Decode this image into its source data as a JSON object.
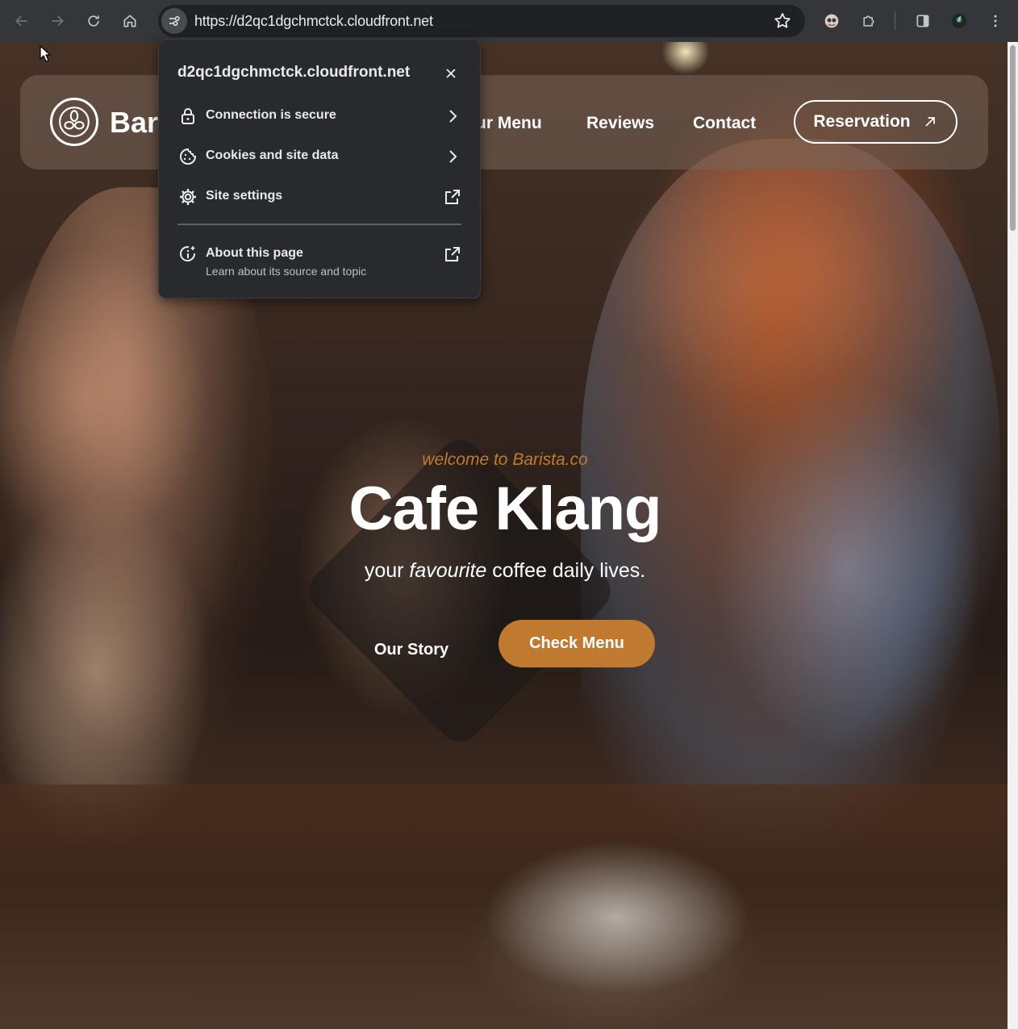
{
  "browser": {
    "url": "https://d2qc1dgchmctck.cloudfront.net",
    "icons": [
      "back-icon",
      "forward-icon",
      "reload-icon",
      "home-icon",
      "site-info-icon",
      "bookmark-star-icon",
      "extension-avatar-icon",
      "extensions-puzzle-icon",
      "side-panel-icon",
      "profile-avatar-icon",
      "more-menu-icon"
    ]
  },
  "site_info_popup": {
    "domain": "d2qc1dgchmctck.cloudfront.net",
    "items": [
      {
        "label": "Connection is secure",
        "icon": "lock-icon",
        "action": "chevron-right-icon"
      },
      {
        "label": "Cookies and site data",
        "icon": "cookie-icon",
        "action": "chevron-right-icon"
      },
      {
        "label": "Site settings",
        "icon": "gear-icon",
        "action": "open-external-icon"
      }
    ],
    "about": {
      "label": "About this page",
      "sublabel": "Learn about its source and topic",
      "icon": "info-sparkle-icon",
      "action": "open-external-icon"
    }
  },
  "site": {
    "logo_text": "Bar",
    "nav": {
      "menu": "ur Menu",
      "reviews": "Reviews",
      "contact": "Contact",
      "reservation": "Reservation"
    },
    "hero": {
      "welcome": "welcome to Barista.co",
      "title": "Cafe Klang",
      "subtitle_pre": "your",
      "subtitle_em": "favourite",
      "subtitle_post": "coffee daily lives.",
      "story_button": "Our Story",
      "menu_button": "Check Menu"
    }
  },
  "colors": {
    "accent": "#c07a30",
    "chrome_toolbar": "#35363a",
    "omnibox": "#202124",
    "popup_bg": "#292a2d"
  }
}
